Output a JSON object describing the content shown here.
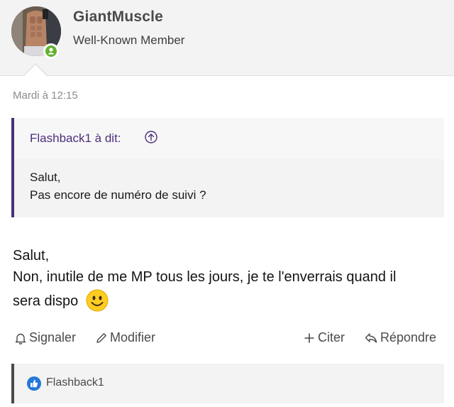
{
  "user": {
    "name": "GiantMuscle",
    "title": "Well-Known Member"
  },
  "post": {
    "date": "Mardi à 12:15",
    "quote": {
      "author_label": "Flashback1 à dit:",
      "lines": [
        "Salut,",
        "Pas encore de numéro de suivi ?"
      ]
    },
    "message_lines": [
      "Salut,",
      "Non, inutile de me MP tous les jours, je te l'enverrais quand il",
      "sera dispo"
    ]
  },
  "actions": {
    "report": "Signaler",
    "edit": "Modifier",
    "quote": "Citer",
    "reply": "Répondre"
  },
  "reactions": {
    "icon": "thumbs-up-icon",
    "users": "Flashback1"
  },
  "colors": {
    "quote_accent": "#4d2f7a",
    "online": "#63b12f",
    "like": "#2577d8"
  }
}
